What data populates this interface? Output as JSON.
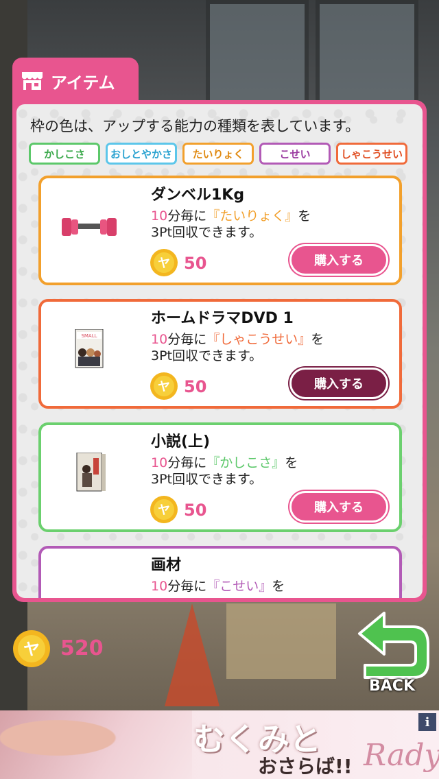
{
  "header": {
    "title": "アイテム"
  },
  "description": "枠の色は、アップする能力の種類を表しています。",
  "tags": [
    "かしこさ",
    "おしとやかさ",
    "たいりょく",
    "こせい",
    "しゃこうせい"
  ],
  "items": [
    {
      "name": "ダンベル1Kg",
      "num": "10",
      "pre": "分毎に",
      "stat": "『たいりょく』",
      "post": "を",
      "line2": "3Pt回収できます。",
      "price": "50",
      "buy_label": "購入する",
      "color": "orange"
    },
    {
      "name": "ホームドラマDVD 1",
      "num": "10",
      "pre": "分毎に",
      "stat": "『しゃこうせい』",
      "post": "を",
      "line2": "3Pt回収できます。",
      "price": "50",
      "buy_label": "購入する",
      "color": "red"
    },
    {
      "name": "小説(上)",
      "num": "10",
      "pre": "分毎に",
      "stat": "『かしこさ』",
      "post": "を",
      "line2": "3Pt回収できます。",
      "price": "50",
      "buy_label": "購入する",
      "color": "green"
    },
    {
      "name": "画材",
      "num": "10",
      "pre": "分毎に",
      "stat": "『こせい』",
      "post": "を",
      "line2": "",
      "price": "",
      "buy_label": "",
      "color": "purple"
    }
  ],
  "balance": "520",
  "back_label": "BACK",
  "ad": {
    "line1": "むくみと",
    "line2": "おさらば!!",
    "brand": "Rady",
    "info": "i"
  },
  "colors": {
    "accent": "#e8558f",
    "active_button": "#7a1f45"
  }
}
